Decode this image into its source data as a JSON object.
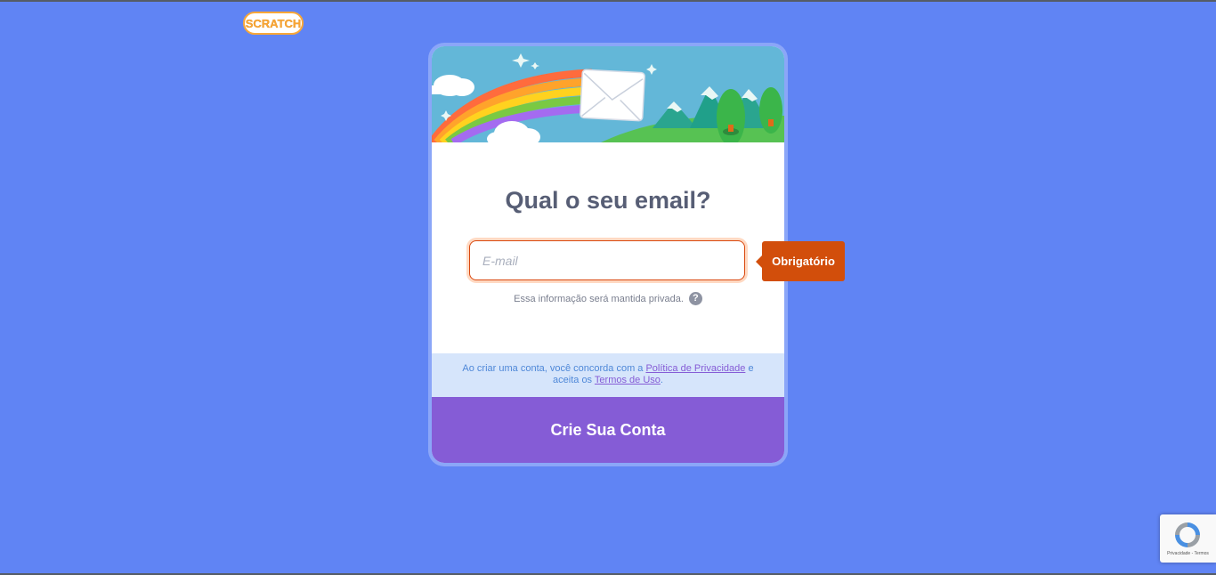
{
  "logo": {
    "text": "SCRATCH",
    "color": "#f9a738"
  },
  "card": {
    "title": "Qual o seu email?",
    "email_placeholder": "E-mail",
    "privacy_note": "Essa informação será mantida privada.",
    "help_icon": "?",
    "terms": {
      "prefix": "Ao criar uma conta, você concorda com a",
      "privacy_link": "Política de Privacidade",
      "middle": "e aceita os",
      "terms_link": "Termos de Uso",
      "suffix": "."
    },
    "create_button": "Crie Sua Conta"
  },
  "tooltip": {
    "text": "Obrigatório"
  },
  "recaptcha": {
    "label": "Privacidade - Termos"
  },
  "colors": {
    "background": "#6084f4",
    "button": "#855cd6",
    "tooltip": "#d24e0b",
    "title": "#575e75"
  }
}
